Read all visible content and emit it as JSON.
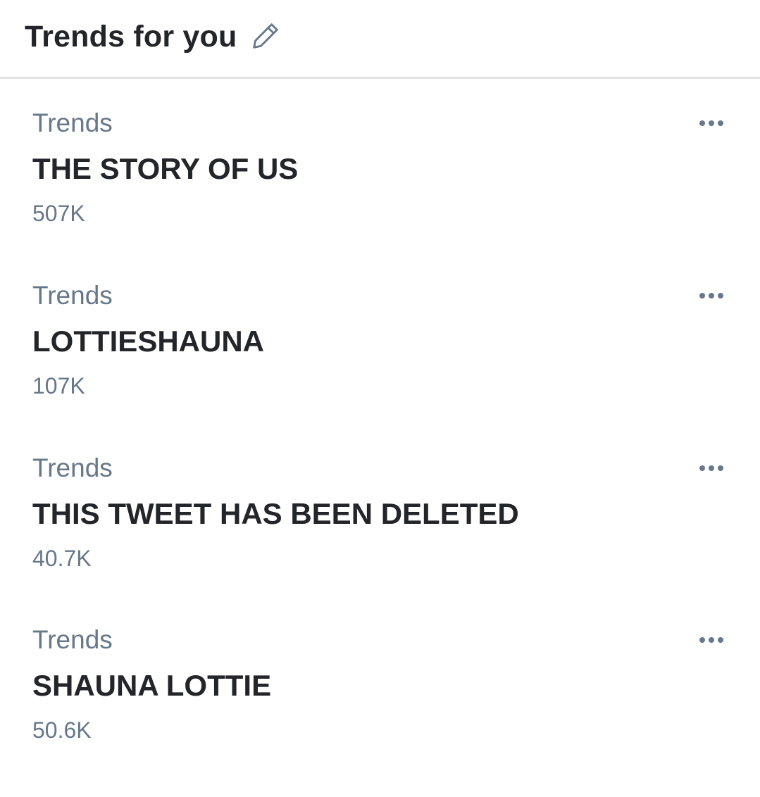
{
  "header": {
    "title": "Trends for you",
    "edit_icon": "pencil-icon"
  },
  "trends": [
    {
      "context": "Trends",
      "name": "THE STORY OF US",
      "count": "507K"
    },
    {
      "context": "Trends",
      "name": "LOTTIESHAUNA",
      "count": "107K"
    },
    {
      "context": "Trends",
      "name": "THIS TWEET HAS BEEN DELETED",
      "count": "40.7K"
    },
    {
      "context": "Trends",
      "name": "SHAUNA LOTTIE",
      "count": "50.6K"
    }
  ],
  "colors": {
    "primary_text": "#222529",
    "secondary_text": "#67788a",
    "divider": "#e1e4e7"
  }
}
